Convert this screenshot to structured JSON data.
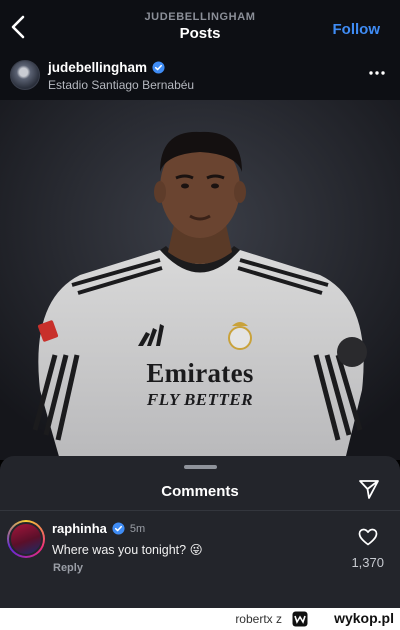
{
  "nav": {
    "subtitle": "JUDEBELLINGHAM",
    "title": "Posts",
    "follow_label": "Follow"
  },
  "post": {
    "username": "judebellingham",
    "location": "Estadio Santiago Bernabéu",
    "jersey_sponsor": "Emirates",
    "jersey_slogan": "FLY BETTER"
  },
  "comments": {
    "title": "Comments",
    "items": [
      {
        "username": "raphinha",
        "time": "5m",
        "text": "Where was you tonight? 😜",
        "reply_label": "Reply",
        "likes": "1,370"
      }
    ]
  },
  "watermark": {
    "user": "robertx  z",
    "brand": "wykop.pl"
  },
  "colors": {
    "accent": "#3f8cf5",
    "sheet": "#23252b",
    "bar": "#0d0f14"
  }
}
